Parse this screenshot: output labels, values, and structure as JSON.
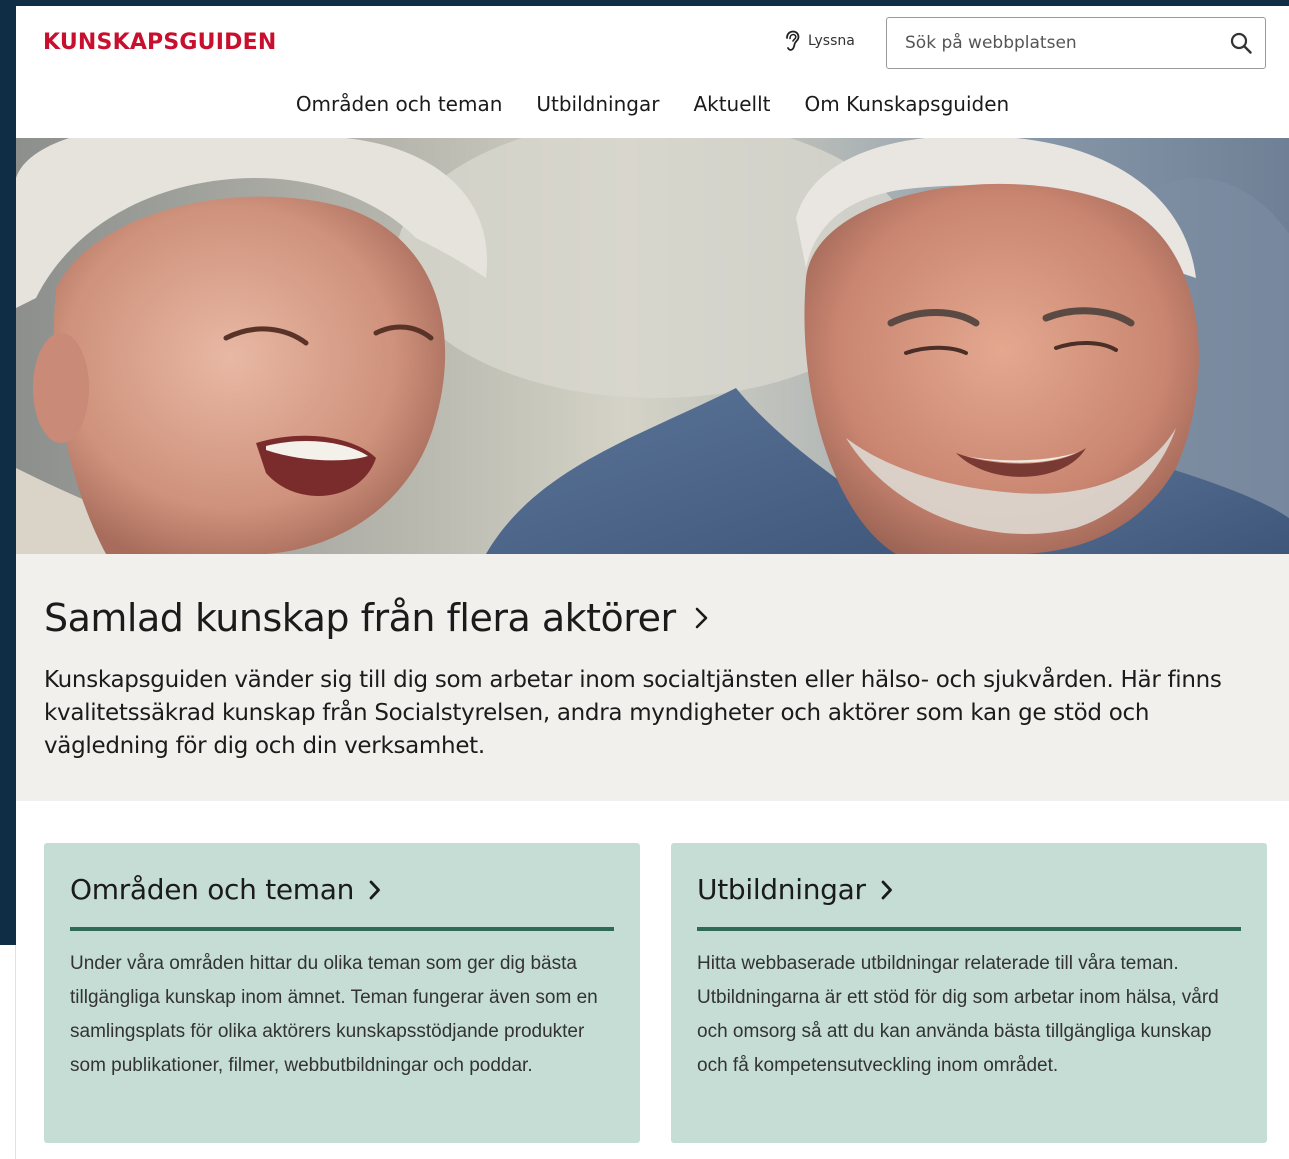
{
  "header": {
    "logo": "KUNSKAPSGUIDEN",
    "listen_label": "Lyssna",
    "search": {
      "placeholder": "Sök på webbplatsen"
    }
  },
  "nav": {
    "items": [
      {
        "label": "Områden och teman"
      },
      {
        "label": "Utbildningar"
      },
      {
        "label": "Aktuellt"
      },
      {
        "label": "Om Kunskapsguiden"
      }
    ]
  },
  "intro": {
    "title": "Samlad kunskap från flera aktörer",
    "text": "Kunskapsguiden vänder sig till dig som arbetar inom socialtjänsten eller hälso- och sjukvården. Här finns kvalitetssäkrad kunskap från Socialstyrelsen, andra myndigheter och aktörer som kan ge stöd och vägledning för dig och din verksamhet."
  },
  "cards": [
    {
      "title": "Områden och teman",
      "text": "Under våra områden hittar du olika teman som ger dig bästa tillgängliga kunskap inom ämnet. Teman fungerar även som en samlingsplats för olika aktörers kunskapsstödjande produkter som publikationer, filmer, webbutbildningar och poddar."
    },
    {
      "title": "Utbildningar",
      "text": "Hitta webbaserade utbildningar relaterade till våra teman. Utbildningarna är ett stöd för dig som arbetar inom hälsa, vård och omsorg så att du kan använda bästa tillgängliga kunskap och få kompetensutveckling inom området."
    }
  ],
  "colors": {
    "brand_red": "#c8102e",
    "frame_navy": "#0f2d44",
    "card_bg": "#c6ddd6",
    "card_rule": "#2e6a57",
    "intro_bg": "#f1f0ed"
  },
  "icons": {
    "listen": "ear-icon",
    "search": "search-icon",
    "chevron": "chevron-right-icon"
  }
}
